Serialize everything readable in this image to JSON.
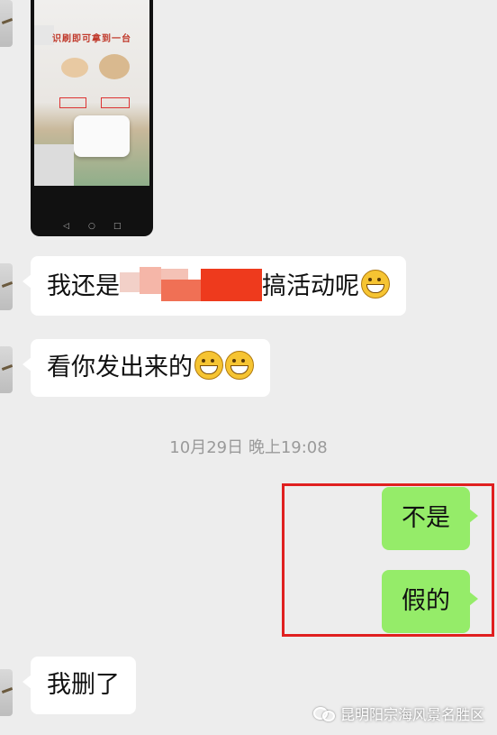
{
  "messages": {
    "m1_prefix": "我还是",
    "m1_suffix": "搞活动呢",
    "m2": "看你发出来的",
    "m3": "不是",
    "m4": "假的",
    "m5": "我删了"
  },
  "image_message": {
    "ad_title": "识刷即可拿到一台"
  },
  "timestamp": "10月29日 晚上19:08",
  "watermark": "昆明阳宗海风景名胜区",
  "colors": {
    "background": "#ededed",
    "outgoing_bubble": "#95ec69",
    "incoming_bubble": "#ffffff",
    "highlight": "#e02020"
  }
}
